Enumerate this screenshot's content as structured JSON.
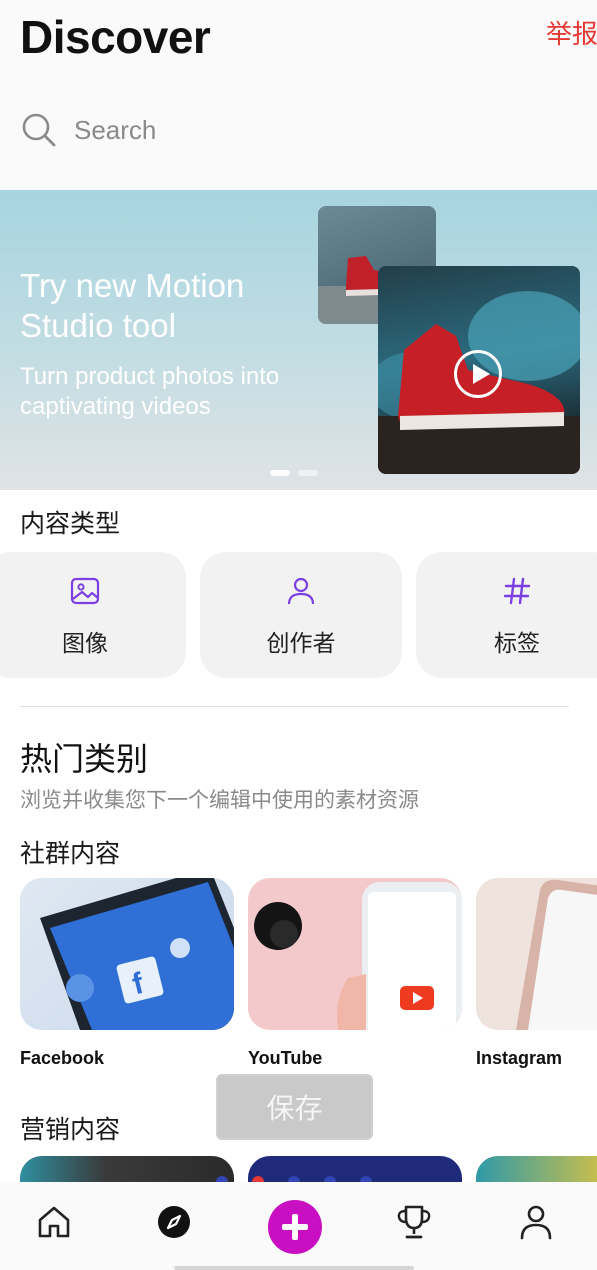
{
  "header": {
    "title": "Discover",
    "report_label": "举报",
    "search_placeholder": "Search"
  },
  "banner": {
    "headline": "Try new Motion Studio tool",
    "subtitle": "Turn product photos into captivating videos",
    "slide_count": 2,
    "active_slide": 1
  },
  "content_types": {
    "heading": "内容类型",
    "items": [
      {
        "label": "图像",
        "icon": "image-icon"
      },
      {
        "label": "创作者",
        "icon": "person-icon"
      },
      {
        "label": "标签",
        "icon": "hashtag-icon"
      }
    ]
  },
  "hot_categories": {
    "heading": "热门类别",
    "subtitle": "浏览并收集您下一个编辑中使用的素材资源"
  },
  "social": {
    "heading": "社群内容",
    "items": [
      {
        "name": "Facebook"
      },
      {
        "name": "YouTube"
      },
      {
        "name": "Instagram"
      }
    ]
  },
  "save_button": {
    "label": "保存"
  },
  "marketing": {
    "heading": "营销内容"
  },
  "page_indicator": {
    "count": 5,
    "active_index": 1
  },
  "tabbar": {
    "items": [
      "home-icon",
      "compass-icon",
      "plus-icon",
      "trophy-icon",
      "profile-icon"
    ],
    "active": "compass-icon"
  },
  "colors": {
    "accent": "#c810c2",
    "icon_purple": "#7c3fe4",
    "report_red": "#e53935",
    "indicator_blue": "#3346b5"
  }
}
